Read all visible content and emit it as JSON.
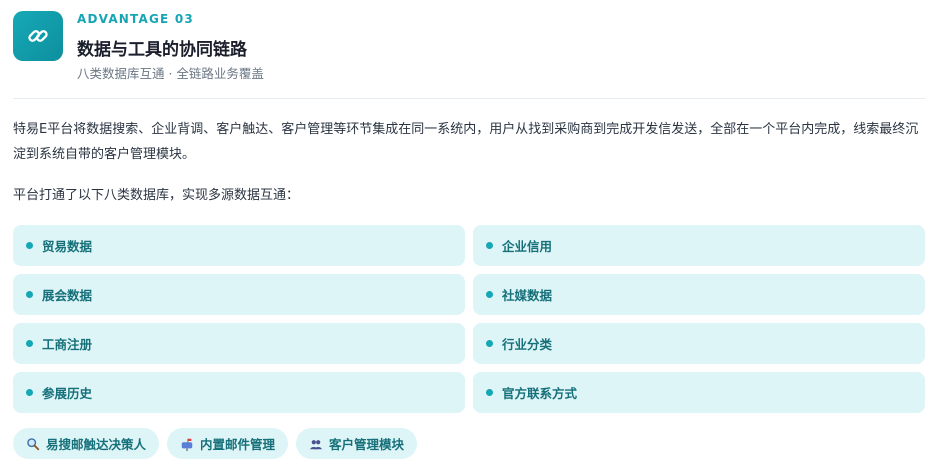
{
  "header": {
    "eyebrow": "ADVANTAGE 03",
    "title": "数据与工具的协同链路",
    "subtitle": "八类数据库互通 · 全链路业务覆盖",
    "logo_icon": "link-icon"
  },
  "body": {
    "paragraph": "特易E平台将数据搜索、企业背调、客户触达、客户管理等环节集成在同一系统内，用户从找到采购商到完成开发信发送，全部在一个平台内完成，线索最终沉淀到系统自带的客户管理模块。",
    "lead": "平台打通了以下八类数据库，实现多源数据互通："
  },
  "databases": [
    {
      "label": "贸易数据"
    },
    {
      "label": "企业信用"
    },
    {
      "label": "展会数据"
    },
    {
      "label": "社媒数据"
    },
    {
      "label": "工商注册"
    },
    {
      "label": "行业分类"
    },
    {
      "label": "参展历史"
    },
    {
      "label": "官方联系方式"
    }
  ],
  "tools": [
    {
      "label": "易搜邮触达决策人",
      "icon": "search-icon"
    },
    {
      "label": "内置邮件管理",
      "icon": "mailbox-icon"
    },
    {
      "label": "客户管理模块",
      "icon": "users-icon"
    }
  ],
  "colors": {
    "accent": "#16a5b3",
    "card_bg": "#def5f7",
    "card_text": "#15707a"
  }
}
